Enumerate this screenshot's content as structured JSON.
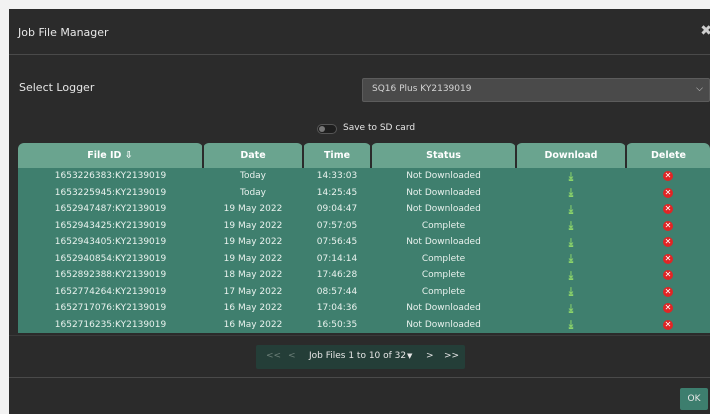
{
  "dialog": {
    "title": "Job File Manager",
    "close_glyph": "✖"
  },
  "logger": {
    "label": "Select Logger",
    "selected": "SQ16 Plus KY2139019"
  },
  "sd_card": {
    "label": "Save to SD card",
    "enabled": false
  },
  "table": {
    "headers": [
      "File ID ⇩",
      "Date",
      "Time",
      "Status",
      "Download",
      "Delete"
    ],
    "rows": [
      [
        "1653226383:KY2139019",
        "Today",
        "14:33:03",
        "Not Downloaded"
      ],
      [
        "1653225945:KY2139019",
        "Today",
        "14:25:45",
        "Not Downloaded"
      ],
      [
        "1652947487:KY2139019",
        "19 May 2022",
        "09:04:47",
        "Not Downloaded"
      ],
      [
        "1652943425:KY2139019",
        "19 May 2022",
        "07:57:05",
        "Complete"
      ],
      [
        "1652943405:KY2139019",
        "19 May 2022",
        "07:56:45",
        "Not Downloaded"
      ],
      [
        "1652940854:KY2139019",
        "19 May 2022",
        "07:14:14",
        "Complete"
      ],
      [
        "1652892388:KY2139019",
        "18 May 2022",
        "17:46:28",
        "Complete"
      ],
      [
        "1652774264:KY2139019",
        "17 May 2022",
        "08:57:44",
        "Complete"
      ],
      [
        "1652717076:KY2139019",
        "16 May 2022",
        "17:04:36",
        "Not Downloaded"
      ],
      [
        "1652716235:KY2139019",
        "16 May 2022",
        "16:50:35",
        "Not Downloaded"
      ]
    ],
    "download_glyph": "⤓",
    "delete_glyph": "✕"
  },
  "pagination": {
    "first": "<<",
    "prev": "<",
    "info": "Job Files 1 to 10 of 32",
    "caret": "▼",
    "next": ">",
    "last": ">>"
  },
  "footer": {
    "ok_label": "OK"
  },
  "colors": {
    "header_green": "#6aa48f",
    "row_green": "#3f7f6e",
    "download_green": "#8bd36a",
    "delete_red": "#e02525",
    "modal_bg": "#2b2b2b"
  }
}
